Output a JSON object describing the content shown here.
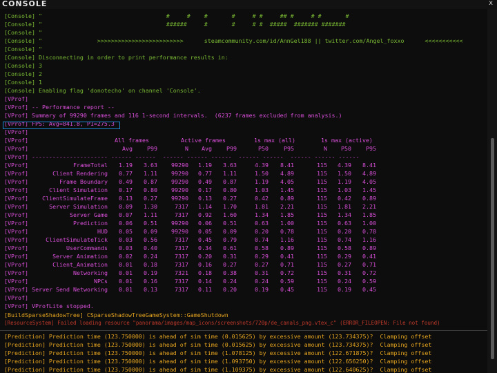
{
  "window": {
    "title": "CONSOLE",
    "close_label": "x"
  },
  "top_lines": [
    {
      "text": "[Console] \"                                    #     #    #       #     # #     ## #     # #       #"
    },
    {
      "text": "[Console] \"                                    ######     #       #     # #  #####  ####### #######"
    },
    {
      "text": "[Console] \""
    },
    {
      "text": "[Console] \"                >>>>>>>>>>>>>>>>>>>>>>>>>      steamcommunity.com/id/AnnGel188 || twitter.com/Angel_foxxo      <<<<<<<<<<<"
    },
    {
      "text": "[Console] \""
    },
    {
      "text": "[Console] Disconnecting in order to print performance results in:"
    },
    {
      "text": "[Console] 3"
    },
    {
      "text": "[Console] 2"
    },
    {
      "text": "[Console] 1"
    },
    {
      "text": "[Console] Enabling flag 'donotecho' on channel 'Console'."
    }
  ],
  "vprof_header": [
    {
      "text": "[VProf]"
    },
    {
      "text": "[VProf] -- Performance report --"
    },
    {
      "text": "[VProf] Summary of 99290 frames and 116 1-second intervals.  (6237 frames excluded from analysis.)"
    },
    {
      "text": "[VProf] FPS: Avg=841.8, P1=275.3"
    },
    {
      "text": "[VProf]"
    }
  ],
  "table": {
    "prefix": "[VProf]",
    "group_headers": [
      "All frames",
      "Active frames",
      "1s max (all)",
      "1s max (active)"
    ],
    "columns": [
      "Avg",
      "P99",
      "N",
      "Avg",
      "P99",
      "P50",
      "P95",
      "N",
      "P50",
      "P95"
    ],
    "divider": "[VProf] ---------------------- ------ ------  ------ ------ ------  ------ ------  ------ ------ ------",
    "rows": [
      {
        "name": "FrameTotal",
        "v": [
          "1.19",
          "3.63",
          "99290",
          "1.19",
          "3.63",
          "4.39",
          "8.41",
          "115",
          "4.39",
          "8.41"
        ]
      },
      {
        "name": "Client Rendering",
        "v": [
          "0.77",
          "1.11",
          "99290",
          "0.77",
          "1.11",
          "1.50",
          "4.89",
          "115",
          "1.50",
          "4.89"
        ]
      },
      {
        "name": "Frame Boundary",
        "v": [
          "0.49",
          "0.87",
          "99290",
          "0.49",
          "0.87",
          "1.19",
          "4.05",
          "115",
          "1.19",
          "4.05"
        ]
      },
      {
        "name": "Client Simulation",
        "v": [
          "0.17",
          "0.80",
          "99290",
          "0.17",
          "0.80",
          "1.03",
          "1.45",
          "115",
          "1.03",
          "1.45"
        ]
      },
      {
        "name": "ClientSimulateFrame",
        "v": [
          "0.13",
          "0.27",
          "99290",
          "0.13",
          "0.27",
          "0.42",
          "0.89",
          "115",
          "0.42",
          "0.89"
        ]
      },
      {
        "name": "Server Simulation",
        "v": [
          "0.09",
          "1.30",
          "7317",
          "1.14",
          "1.70",
          "1.81",
          "2.21",
          "115",
          "1.81",
          "2.21"
        ]
      },
      {
        "name": "Server Game",
        "v": [
          "0.07",
          "1.11",
          "7317",
          "0.92",
          "1.60",
          "1.34",
          "1.85",
          "115",
          "1.34",
          "1.85"
        ]
      },
      {
        "name": "Prediction",
        "v": [
          "0.06",
          "0.51",
          "99290",
          "0.06",
          "0.51",
          "0.63",
          "1.00",
          "115",
          "0.63",
          "1.00"
        ]
      },
      {
        "name": "HUD",
        "v": [
          "0.05",
          "0.09",
          "99290",
          "0.05",
          "0.09",
          "0.20",
          "0.78",
          "115",
          "0.20",
          "0.78"
        ]
      },
      {
        "name": "ClientSimulateTick",
        "v": [
          "0.03",
          "0.56",
          "7317",
          "0.45",
          "0.79",
          "0.74",
          "1.16",
          "115",
          "0.74",
          "1.16"
        ]
      },
      {
        "name": "UserCommands",
        "v": [
          "0.03",
          "0.40",
          "7317",
          "0.34",
          "0.61",
          "0.58",
          "0.89",
          "115",
          "0.58",
          "0.89"
        ]
      },
      {
        "name": "Server Animation",
        "v": [
          "0.02",
          "0.24",
          "7317",
          "0.20",
          "0.31",
          "0.29",
          "0.41",
          "115",
          "0.29",
          "0.41"
        ]
      },
      {
        "name": "Client_Animation",
        "v": [
          "0.01",
          "0.18",
          "7317",
          "0.16",
          "0.27",
          "0.27",
          "0.71",
          "115",
          "0.27",
          "0.71"
        ]
      },
      {
        "name": "Networking",
        "v": [
          "0.01",
          "0.19",
          "7321",
          "0.18",
          "0.38",
          "0.31",
          "0.72",
          "115",
          "0.31",
          "0.72"
        ]
      },
      {
        "name": "NPCs",
        "v": [
          "0.01",
          "0.16",
          "7317",
          "0.14",
          "0.24",
          "0.24",
          "0.59",
          "115",
          "0.24",
          "0.59"
        ]
      },
      {
        "name": "Server Send Networking",
        "v": [
          "0.01",
          "0.13",
          "7317",
          "0.11",
          "0.20",
          "0.19",
          "0.45",
          "115",
          "0.19",
          "0.45"
        ]
      }
    ]
  },
  "vprof_footer": [
    {
      "text": "[VProf]"
    },
    {
      "text": "[VProf] VProfLite stopped."
    }
  ],
  "build_line": {
    "text": "[BuildSparseShadowTree] CSparseShadowTreeGameSystem::GameShutdown"
  },
  "resource_line": {
    "text": "[ResourceSystem] Failed loading resource \"panorama/images/map_icons/screenshots/720p/de_canals_png.vtex_c\" (ERROR_FILEOPEN: File not found)"
  },
  "prediction_lines": [
    {
      "text": "[Prediction] Prediction time (123.750000) is ahead of sim time (0.015625) by excessive amount (123.734375)?  Clamping offset"
    },
    {
      "text": "[Prediction] Prediction time (123.750000) is ahead of sim time (0.015625) by excessive amount (123.734375)?  Clamping offset"
    },
    {
      "text": "[Prediction] Prediction time (123.750000) is ahead of sim time (1.078125) by excessive amount (122.671875)?  Clamping offset"
    },
    {
      "text": "[Prediction] Prediction time (123.750000) is ahead of sim time (1.093750) by excessive amount (122.656250)?  Clamping offset"
    },
    {
      "text": "[Prediction] Prediction time (123.750000) is ahead of sim time (1.109375) by excessive amount (122.640625)?  Clamping offset"
    }
  ],
  "colors": {
    "console": "#79b833",
    "vprof": "#d94fd9",
    "warning": "#e6a51f",
    "error": "#c0392b",
    "highlight": "#1f8ad8"
  }
}
